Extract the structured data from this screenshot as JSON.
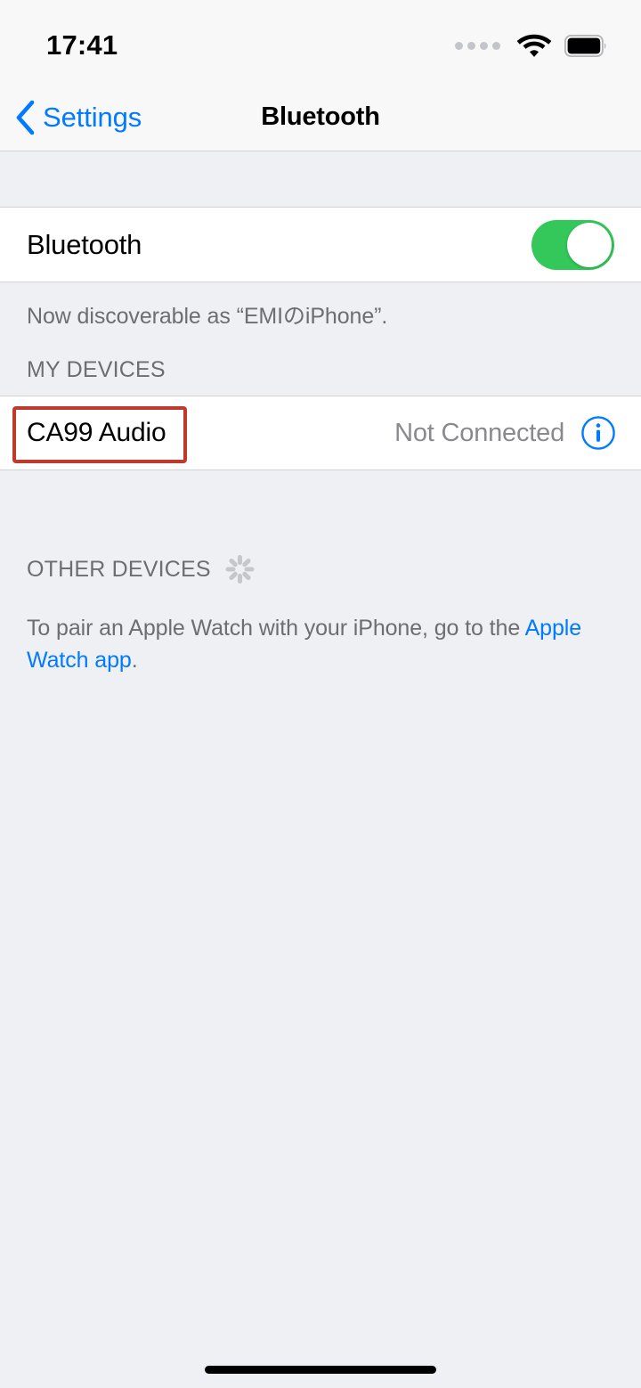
{
  "status_bar": {
    "time": "17:41",
    "signal_icon": "signal-dots-icon",
    "wifi_icon": "wifi-icon",
    "battery_icon": "battery-full-icon"
  },
  "nav": {
    "back_label": "Settings",
    "back_icon": "chevron-left-icon",
    "title": "Bluetooth"
  },
  "bluetooth": {
    "label": "Bluetooth",
    "toggle_state": "on",
    "toggle_color": "#34c759",
    "footnote": "Now discoverable as “EMIのiPhone”."
  },
  "my_devices": {
    "header": "MY DEVICES",
    "devices": [
      {
        "name": "CA99 Audio",
        "status": "Not Connected",
        "info_icon": "info-circle-icon",
        "highlighted": true,
        "highlight_color": "#c0392b"
      }
    ]
  },
  "other_devices": {
    "header": "OTHER DEVICES",
    "spinner_icon": "activity-spinner-icon",
    "pair_text_before": "To pair an Apple Watch with your iPhone, go to the ",
    "pair_link": "Apple Watch app",
    "pair_text_after": ".",
    "link_color": "#007aff"
  },
  "home_indicator": "home-indicator"
}
